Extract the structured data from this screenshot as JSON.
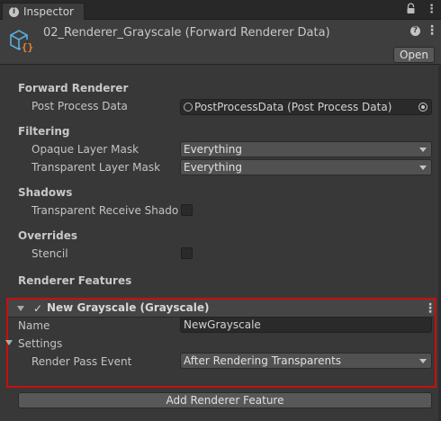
{
  "tab": {
    "title": "Inspector",
    "icons": [
      "info-icon",
      "lock-icon",
      "kebab-menu-icon"
    ]
  },
  "header": {
    "asset_title": "02_Renderer_Grayscale (Forward Renderer Data)",
    "open_label": "Open",
    "help_glyph": "?",
    "menu_glyph": "⋮"
  },
  "sections": {
    "forward_renderer": {
      "heading": "Forward Renderer",
      "post_process_label": "Post Process Data",
      "post_process_value": "PostProcessData (Post Process Data)"
    },
    "filtering": {
      "heading": "Filtering",
      "opaque_label": "Opaque Layer Mask",
      "opaque_value": "Everything",
      "transparent_label": "Transparent Layer Mask",
      "transparent_value": "Everything"
    },
    "shadows": {
      "heading": "Shadows",
      "receive_label": "Transparent Receive Shadows",
      "receive_checked": false
    },
    "overrides": {
      "heading": "Overrides",
      "stencil_label": "Stencil",
      "stencil_checked": false
    },
    "renderer_features": {
      "heading": "Renderer Features",
      "feature": {
        "check_glyph": "✓",
        "title": "New Grayscale (Grayscale)",
        "name_label": "Name",
        "name_value": "NewGrayscale",
        "settings_label": "Settings",
        "render_pass_label": "Render Pass Event",
        "render_pass_value": "After Rendering Transparents"
      },
      "add_label": "Add Renderer Feature"
    }
  },
  "colors": {
    "highlight_border": "#c80f0f",
    "panel_bg": "#383838",
    "field_bg": "#2a2a2a"
  }
}
